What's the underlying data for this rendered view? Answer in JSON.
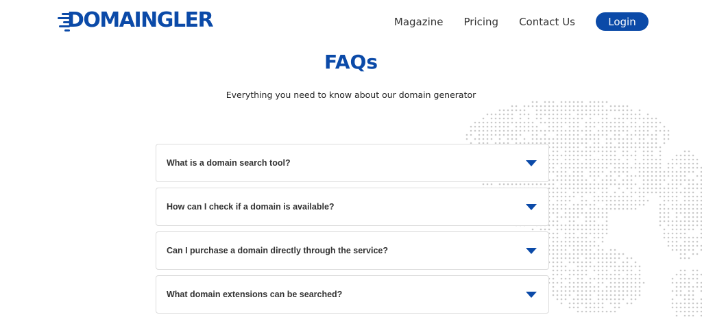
{
  "brand": {
    "logo_text": "DOMAINGLER",
    "color": "#0b4aa8"
  },
  "nav": {
    "items": [
      {
        "label": "Magazine"
      },
      {
        "label": "Pricing"
      },
      {
        "label": "Contact Us"
      }
    ],
    "login_label": "Login"
  },
  "hero": {
    "title": "FAQs",
    "subtitle": "Everything you need to know about our domain generator"
  },
  "faqs": [
    {
      "question": "What is a domain search tool?",
      "icon": "chevron-down-icon"
    },
    {
      "question": "How can I check if a domain is available?",
      "icon": "chevron-down-icon"
    },
    {
      "question": "Can I purchase a domain directly through the service?",
      "icon": "chevron-down-icon"
    },
    {
      "question": "What domain extensions can be searched?",
      "icon": "chevron-down-icon"
    }
  ],
  "decor": {
    "background": "dotted-world-map"
  }
}
